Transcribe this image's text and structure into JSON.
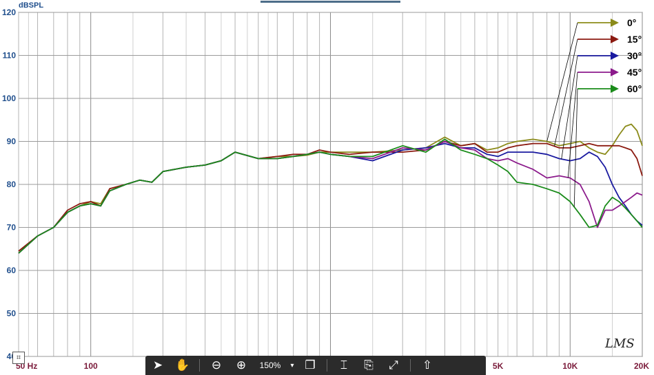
{
  "chart_data": {
    "type": "line",
    "ylabel": "dBSPL",
    "x_scale": "log",
    "xlim": [
      50,
      20000
    ],
    "ylim": [
      40,
      120
    ],
    "yticks": [
      "40",
      "50",
      "60",
      "70",
      "80",
      "90",
      "100",
      "110",
      "120"
    ],
    "xticks": [
      {
        "value": 50,
        "label": "50 Hz"
      },
      {
        "value": 100,
        "label": "100"
      },
      {
        "value": 5000,
        "label": "5K"
      },
      {
        "value": 10000,
        "label": "10K"
      },
      {
        "value": 20000,
        "label": "20K"
      }
    ],
    "grid": true,
    "legend_position": "top-right",
    "series": [
      {
        "name": "0°",
        "color": "#8b8b1a",
        "x": [
          50,
          60,
          70,
          80,
          90,
          100,
          110,
          120,
          140,
          160,
          180,
          200,
          250,
          300,
          350,
          400,
          500,
          600,
          700,
          800,
          900,
          1000,
          1200,
          1500,
          2000,
          2500,
          3000,
          3500,
          4000,
          4500,
          5000,
          5500,
          6000,
          7000,
          8000,
          9000,
          10000,
          11000,
          12000,
          13000,
          14000,
          15000,
          16000,
          17000,
          18000,
          19000,
          20000
        ],
        "y": [
          64.5,
          68,
          70,
          73.5,
          75,
          76,
          75.5,
          79,
          80,
          81,
          80.5,
          83,
          84,
          84.5,
          85.5,
          87.5,
          86,
          86.5,
          86.5,
          86.8,
          87.5,
          87.5,
          87.5,
          87.5,
          88,
          88.5,
          91,
          89,
          89.5,
          88,
          88.5,
          89.5,
          90,
          90.5,
          90,
          89,
          89.5,
          90,
          88.5,
          87.5,
          87,
          89,
          91.5,
          93.5,
          94,
          92.5,
          89
        ]
      },
      {
        "name": "15°",
        "color": "#8b1a10",
        "x": [
          50,
          60,
          70,
          80,
          90,
          100,
          110,
          120,
          140,
          160,
          180,
          200,
          250,
          300,
          350,
          400,
          500,
          600,
          700,
          800,
          900,
          1000,
          1200,
          1500,
          2000,
          2500,
          3000,
          3500,
          4000,
          4500,
          5000,
          5500,
          6000,
          7000,
          8000,
          9000,
          10000,
          11000,
          12000,
          13000,
          14000,
          15000,
          16000,
          17000,
          18000,
          19000,
          20000
        ],
        "y": [
          64.5,
          68,
          70,
          74,
          75.5,
          76,
          75,
          79,
          80,
          81,
          80.5,
          83,
          84,
          84.5,
          85.5,
          87.5,
          86,
          86.5,
          87,
          87,
          88,
          87.5,
          87,
          87.5,
          87.5,
          88,
          90,
          89,
          89.5,
          87.5,
          87.5,
          88.5,
          89,
          89.5,
          89.5,
          88.5,
          88.5,
          89,
          89.5,
          89,
          89,
          89,
          89,
          88.5,
          88,
          86,
          82
        ]
      },
      {
        "name": "30°",
        "color": "#1a1aa0",
        "x": [
          50,
          60,
          70,
          80,
          90,
          100,
          110,
          120,
          140,
          160,
          180,
          200,
          250,
          300,
          350,
          400,
          500,
          600,
          700,
          800,
          900,
          1000,
          1200,
          1500,
          2000,
          2500,
          3000,
          3500,
          4000,
          4500,
          5000,
          5500,
          6000,
          7000,
          8000,
          9000,
          10000,
          11000,
          12000,
          13000,
          14000,
          15000,
          16000,
          17000,
          18000,
          19000,
          20000
        ],
        "y": [
          64,
          68,
          70,
          73.5,
          75,
          75.5,
          75,
          78.5,
          80,
          81,
          80.5,
          83,
          84,
          84.5,
          85.5,
          87.5,
          86,
          86,
          86.5,
          87,
          87.5,
          87,
          86.5,
          85.5,
          88,
          88.5,
          89.5,
          88.5,
          88.5,
          87,
          86.5,
          87.5,
          87.5,
          87.5,
          87,
          86,
          85.5,
          86,
          87.5,
          86.5,
          84,
          80,
          77,
          75,
          73,
          71.5,
          70.5
        ]
      },
      {
        "name": "45°",
        "color": "#8b1a8b",
        "x": [
          50,
          60,
          70,
          80,
          90,
          100,
          110,
          120,
          140,
          160,
          180,
          200,
          250,
          300,
          350,
          400,
          500,
          600,
          700,
          800,
          900,
          1000,
          1200,
          1500,
          2000,
          2500,
          3000,
          3500,
          4000,
          4500,
          5000,
          5500,
          6000,
          7000,
          8000,
          9000,
          10000,
          11000,
          12000,
          13000,
          14000,
          15000,
          16000,
          17000,
          18000,
          19000,
          20000
        ],
        "y": [
          64,
          68,
          70,
          73.5,
          75,
          75.5,
          75,
          78.5,
          80,
          81,
          80.5,
          83,
          84,
          84.5,
          85.5,
          87.5,
          86,
          86,
          86.5,
          87,
          87.5,
          87,
          86.5,
          86,
          88.5,
          88,
          90,
          88.5,
          88,
          86,
          85.5,
          86,
          85,
          83.5,
          81.5,
          82,
          81.5,
          80,
          76,
          70,
          74,
          74,
          75,
          76,
          77,
          78,
          77.5
        ]
      },
      {
        "name": "60°",
        "color": "#1a8b1a",
        "x": [
          50,
          60,
          70,
          80,
          90,
          100,
          110,
          120,
          140,
          160,
          180,
          200,
          250,
          300,
          350,
          400,
          500,
          600,
          700,
          800,
          900,
          1000,
          1200,
          1500,
          2000,
          2500,
          3000,
          3500,
          4000,
          4500,
          5000,
          5500,
          6000,
          7000,
          8000,
          9000,
          10000,
          11000,
          12000,
          13000,
          14000,
          15000,
          16000,
          17000,
          18000,
          19000,
          20000
        ],
        "y": [
          64,
          68,
          70,
          73.5,
          75,
          75.5,
          75,
          78.5,
          80,
          81,
          80.5,
          83,
          84,
          84.5,
          85.5,
          87.5,
          86,
          86,
          86.5,
          87,
          87.5,
          87,
          86.5,
          86.5,
          89,
          87.5,
          90.5,
          88,
          87,
          86,
          84.5,
          83,
          80.5,
          80,
          79,
          78,
          76,
          73,
          70,
          70.5,
          75,
          77,
          76,
          74.5,
          73,
          71.5,
          70
        ]
      }
    ]
  },
  "watermark": "LMS",
  "toolbar": {
    "zoom_value": "150%",
    "icons": [
      "select-arrow-icon",
      "hand-pan-icon",
      "zoom-out-icon",
      "zoom-in-icon",
      "copy-pages-icon",
      "fit-page-icon",
      "add-page-icon",
      "expand-icon",
      "share-icon"
    ]
  }
}
